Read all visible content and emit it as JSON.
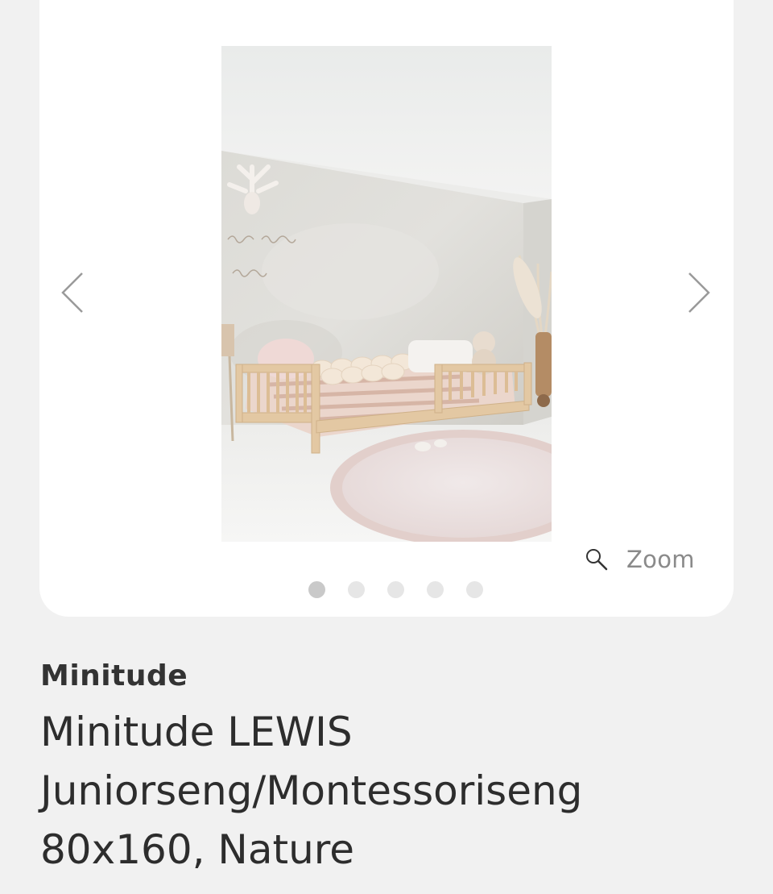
{
  "gallery": {
    "image_alt": "Minitude LEWIS bed in a room",
    "prev_icon": "chevron-left-icon",
    "next_icon": "chevron-right-icon",
    "zoom_label": "Zoom",
    "zoom_icon": "magnifier-icon",
    "dots_total": 5,
    "active_dot": 1
  },
  "product": {
    "brand": "Minitude",
    "title_lines": [
      "Minitude LEWIS",
      "Juniorseng/Montessoriseng",
      "80x160, Nature"
    ]
  },
  "colors": {
    "background": "#f1f1f1",
    "card": "#ffffff",
    "dot_active": "#c9c9c9",
    "dot_inactive": "#e6e6e6"
  }
}
